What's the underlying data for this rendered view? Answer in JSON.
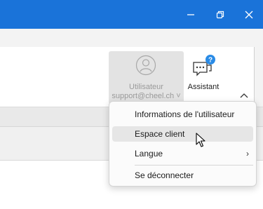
{
  "window_controls": {
    "minimize_icon": "minimize-icon",
    "restore_icon": "restore-icon",
    "close_icon": "close-icon"
  },
  "ribbon": {
    "user_button": {
      "label": "Utilisateur",
      "account": "support@cheel.ch ˅",
      "icon": "user-avatar-icon"
    },
    "assistant_button": {
      "label": "Assistant",
      "icon": "assistant-chat-help-icon"
    },
    "collapse_icon": "chevron-up-icon"
  },
  "user_menu": {
    "items": [
      {
        "label": "Informations de l'utilisateur"
      },
      {
        "label": "Espace client",
        "hovered": true
      },
      {
        "label": "Langue",
        "submenu": true,
        "submenu_arrow": "›"
      },
      {
        "label": "Se déconnecter"
      }
    ]
  },
  "colors": {
    "titlebar": "#1a73d9",
    "assistant_accent": "#2a8be6",
    "menu_hover": "#e6e6e6"
  }
}
